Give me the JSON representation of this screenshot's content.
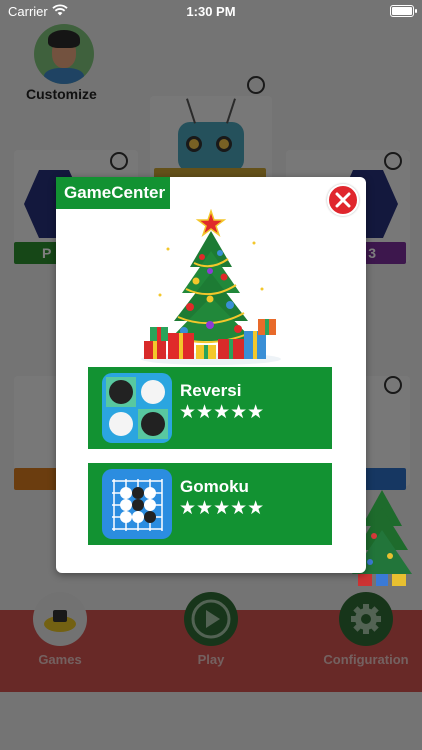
{
  "status_bar": {
    "carrier": "Carrier",
    "time": "1:30 PM",
    "wifi_icon": "wifi-icon",
    "battery_icon": "battery-icon"
  },
  "background": {
    "customize_label": "Customize",
    "tile_left_fragment": "P",
    "tile_right_fragment": "3",
    "nav": {
      "games_label": "Games",
      "play_label": "Play",
      "configuration_label": "Configuration"
    }
  },
  "modal": {
    "title": "GameCenter",
    "close_icon": "close-icon",
    "games": [
      {
        "name": "Reversi",
        "rating": "★★★★★",
        "icon": "reversi-board-icon"
      },
      {
        "name": "Gomoku",
        "rating": "★★★★★",
        "icon": "gomoku-board-icon"
      }
    ]
  },
  "colors": {
    "accent_green": "#129232",
    "close_red": "#e0262d",
    "nav_bar_red": "#d0524f"
  }
}
